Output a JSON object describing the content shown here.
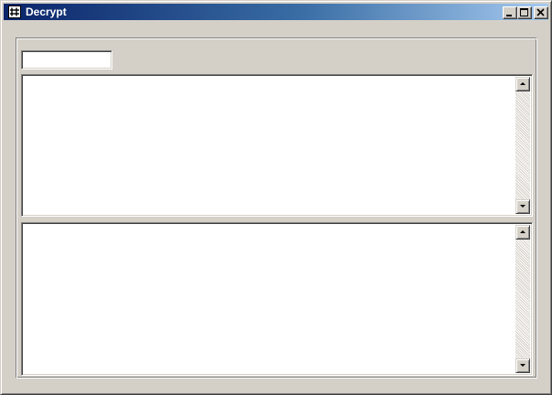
{
  "window": {
    "title": "Decrypt",
    "icons": {
      "app": "app-icon",
      "minimize": "minimize-icon",
      "maximize": "maximize-icon",
      "close": "close-icon"
    }
  },
  "key_input": {
    "value": ""
  },
  "input_text": {
    "value": ""
  },
  "output_text": {
    "value": ""
  },
  "colors": {
    "titlebar_start": "#0a246a",
    "titlebar_end": "#a6caf0",
    "face": "#d4d0c8"
  }
}
